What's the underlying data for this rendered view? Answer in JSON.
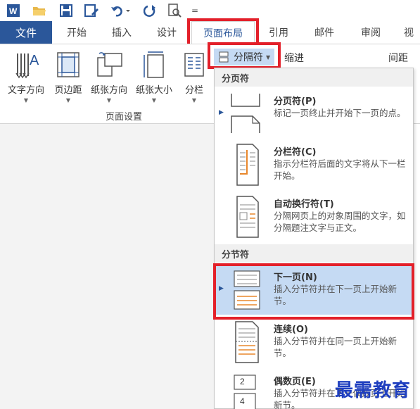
{
  "quick_access": {
    "icons": [
      "word-icon",
      "open-folder-icon",
      "save-icon",
      "edit-document-icon",
      "undo-icon",
      "redo-icon",
      "print-preview-icon",
      "customize-icon"
    ],
    "customize_glyph": "="
  },
  "tabs": {
    "file": "文件",
    "items": [
      "开始",
      "插入",
      "设计",
      "页面布局",
      "引用",
      "邮件",
      "审阅",
      "视"
    ],
    "active": "页面布局"
  },
  "ribbon": {
    "buttons": [
      "文字方向",
      "页边距",
      "纸张方向",
      "纸张大小",
      "分栏"
    ],
    "group_label": "页面设置",
    "breaks_label": "分隔符",
    "indent_label": "缩进",
    "spacing_label": "间距"
  },
  "menu": {
    "page_breaks_header": "分页符",
    "section_breaks_header": "分节符",
    "items": [
      {
        "title": "分页符(P)",
        "desc": "标记一页终止并开始下一页的点。"
      },
      {
        "title": "分栏符(C)",
        "desc": "指示分栏符后面的文字将从下一栏开始。"
      },
      {
        "title": "自动换行符(T)",
        "desc": "分隔网页上的对象周围的文字，如分隔题注文字与正文。"
      },
      {
        "title": "下一页(N)",
        "desc": "插入分节符并在下一页上开始新节。"
      },
      {
        "title": "连续(O)",
        "desc": "插入分节符并在同一页上开始新节。"
      },
      {
        "title": "偶数页(E)",
        "desc": "插入分节符并在下一偶数页上开始新节。"
      }
    ],
    "even_icon_number": "2",
    "even_icon_number2": "4"
  },
  "watermark": "最需教育",
  "colors": {
    "accent": "#2b579a",
    "highlight": "#c5daf3",
    "annotation_red": "#e3202a",
    "watermark": "#1f3fbf"
  }
}
